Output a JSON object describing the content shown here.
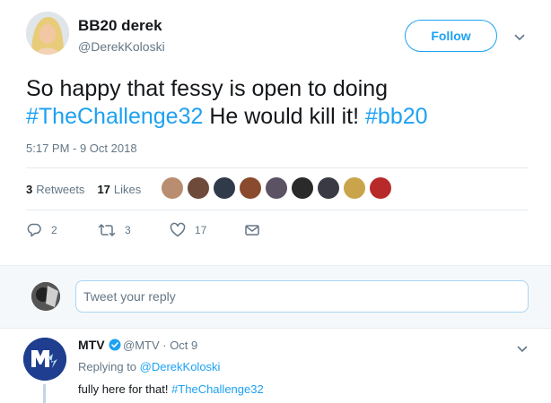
{
  "tweet": {
    "author_name": "BB20 derek",
    "author_handle": "@DerekKoloski",
    "follow_label": "Follow",
    "text_part1": "So happy that fessy is open to doing ",
    "hashtag1": "#TheChallenge32",
    "text_part2": " He would kill it! ",
    "hashtag2": "#bb20",
    "timestamp": "5:17 PM - 9 Oct 2018",
    "retweets_count": "3",
    "retweets_label": "Retweets",
    "likes_count": "17",
    "likes_label": "Likes",
    "liker_colors": [
      "#b98d6f",
      "#6d4a39",
      "#2f3a4a",
      "#8a4a2e",
      "#5b5263",
      "#2a2a2a",
      "#3a3a44",
      "#c9a44a",
      "#b82a2a"
    ],
    "actions": {
      "reply_count": "2",
      "retweet_count": "3",
      "like_count": "17"
    }
  },
  "reply_box": {
    "placeholder": "Tweet your reply"
  },
  "reply_tweet": {
    "author_name": "MTV",
    "meta": "@MTV · Oct 9",
    "replying_prefix": "Replying to ",
    "replying_to": "@DerekKoloski",
    "text_part1": "fully here for that! ",
    "hashtag": "#TheChallenge32"
  },
  "colors": {
    "accent": "#1da1f2",
    "muted": "#657786",
    "mtv_blue": "#1f3e8f"
  }
}
